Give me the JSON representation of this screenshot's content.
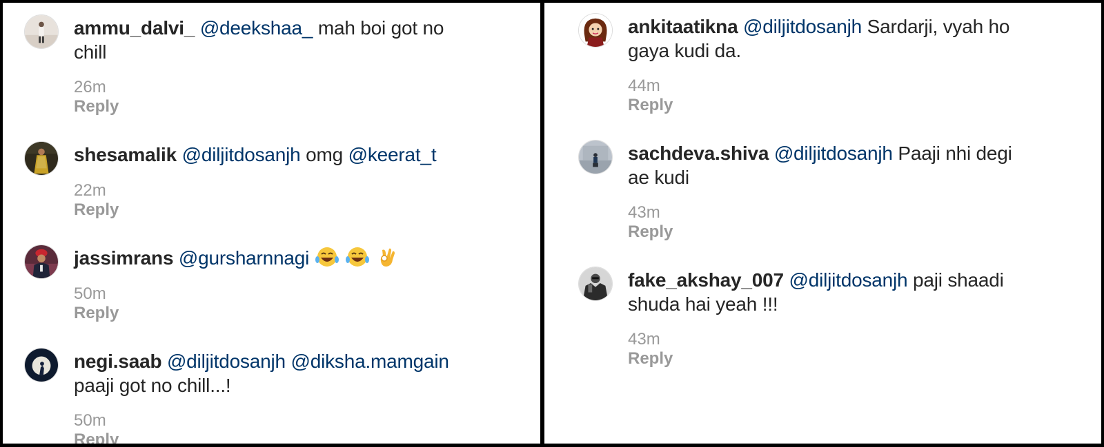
{
  "left_column": [
    {
      "username": "ammu_dalvi_",
      "segments": [
        {
          "type": "mention",
          "text": "@deekshaa_"
        },
        {
          "type": "text",
          "text": "mah boi got no"
        }
      ],
      "line2": "chill",
      "time": "26m",
      "reply": "Reply",
      "avatar_icon": "avatar-person-standing"
    },
    {
      "username": "shesamalik",
      "segments": [
        {
          "type": "mention",
          "text": "@diljitdosanjh"
        },
        {
          "type": "text",
          "text": "omg"
        },
        {
          "type": "mention",
          "text": "@keerat_t"
        }
      ],
      "time": "22m",
      "reply": "Reply",
      "avatar_icon": "avatar-woman-dress"
    },
    {
      "username": "jassimrans",
      "segments": [
        {
          "type": "mention",
          "text": "@gursharnnagi"
        }
      ],
      "emojis": [
        "tears-of-joy-emoji",
        "tears-of-joy-emoji",
        "ok-hand-emoji"
      ],
      "time": "50m",
      "reply": "Reply",
      "avatar_icon": "avatar-man-turban"
    },
    {
      "username": "negi.saab",
      "segments": [
        {
          "type": "mention",
          "text": "@diljitdosanjh"
        },
        {
          "type": "mention",
          "text": "@diksha.mamgain"
        }
      ],
      "line2": "paaji got no chill...!",
      "time": "50m",
      "reply": "Reply",
      "avatar_icon": "avatar-moon-silhouette"
    }
  ],
  "right_column": [
    {
      "username": "ankitaatikna",
      "segments": [
        {
          "type": "mention",
          "text": "@diljitdosanjh"
        },
        {
          "type": "text",
          "text": "Sardarji, vyah ho"
        }
      ],
      "line2": "gaya kudi da.",
      "time": "44m",
      "reply": "Reply",
      "avatar_icon": "avatar-cartoon-girl"
    },
    {
      "username": "sachdeva.shiva",
      "segments": [
        {
          "type": "mention",
          "text": "@diljitdosanjh"
        },
        {
          "type": "text",
          "text": "Paaji nhi degi"
        }
      ],
      "line2": "ae kudi",
      "time": "43m",
      "reply": "Reply",
      "avatar_icon": "avatar-person-sitting"
    },
    {
      "username": "fake_akshay_007",
      "segments": [
        {
          "type": "mention",
          "text": "@diljitdosanjh"
        },
        {
          "type": "text",
          "text": "paji shaadi"
        }
      ],
      "line2": "shuda hai yeah !!!",
      "time": "43m",
      "reply": "Reply",
      "avatar_icon": "avatar-man-bw"
    }
  ],
  "colors": {
    "username": "#262626",
    "mention": "#003569",
    "meta": "#999999",
    "divider": "#000000"
  }
}
